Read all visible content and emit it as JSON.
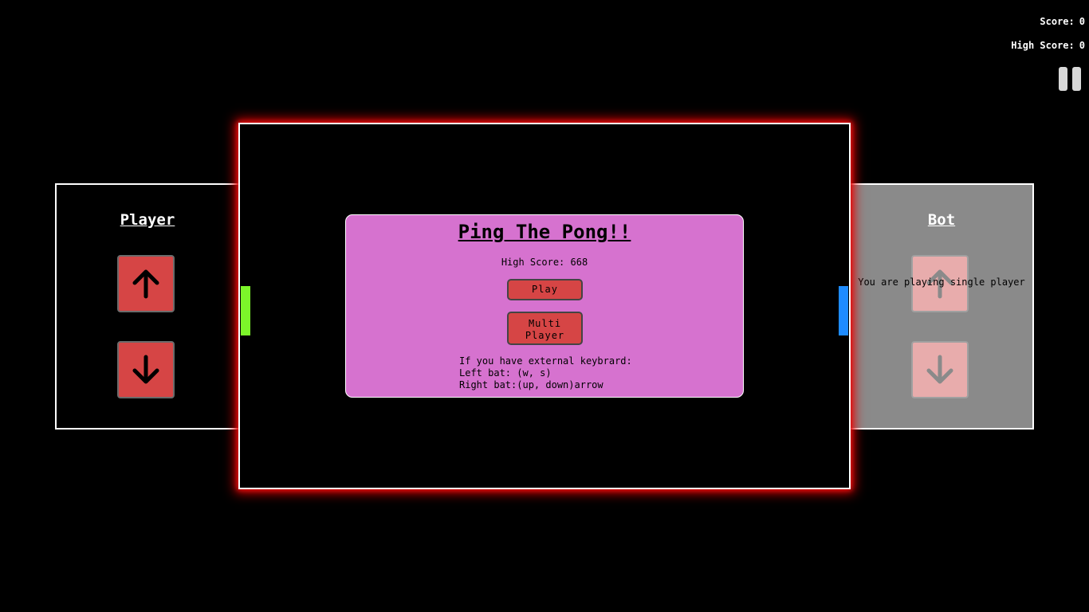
{
  "hud": {
    "score_label": "Score:",
    "score_value": "0",
    "high_score_label": "High Score:",
    "high_score_value": "0"
  },
  "panels": {
    "left": {
      "title": "Player"
    },
    "right": {
      "title": "Bot",
      "note": "You are playing single player"
    }
  },
  "menu": {
    "title": "Ping The Pong!!",
    "high_score": "High Score: 668",
    "play_label": "Play",
    "multi_line1": "Multi",
    "multi_line2": "Player",
    "instructions": [
      "If you have external keybrard:",
      "Left bat: (w, s)",
      "Right bat:(up, down)arrow"
    ]
  },
  "colors": {
    "left_bat": "#7cf52a",
    "right_bat": "#1e8cff",
    "button": "#d64545",
    "menu_bg": "#d672cf",
    "board_glow": "#e00000"
  },
  "icons": [
    "pause-icon",
    "arrow-up-icon",
    "arrow-down-icon"
  ]
}
